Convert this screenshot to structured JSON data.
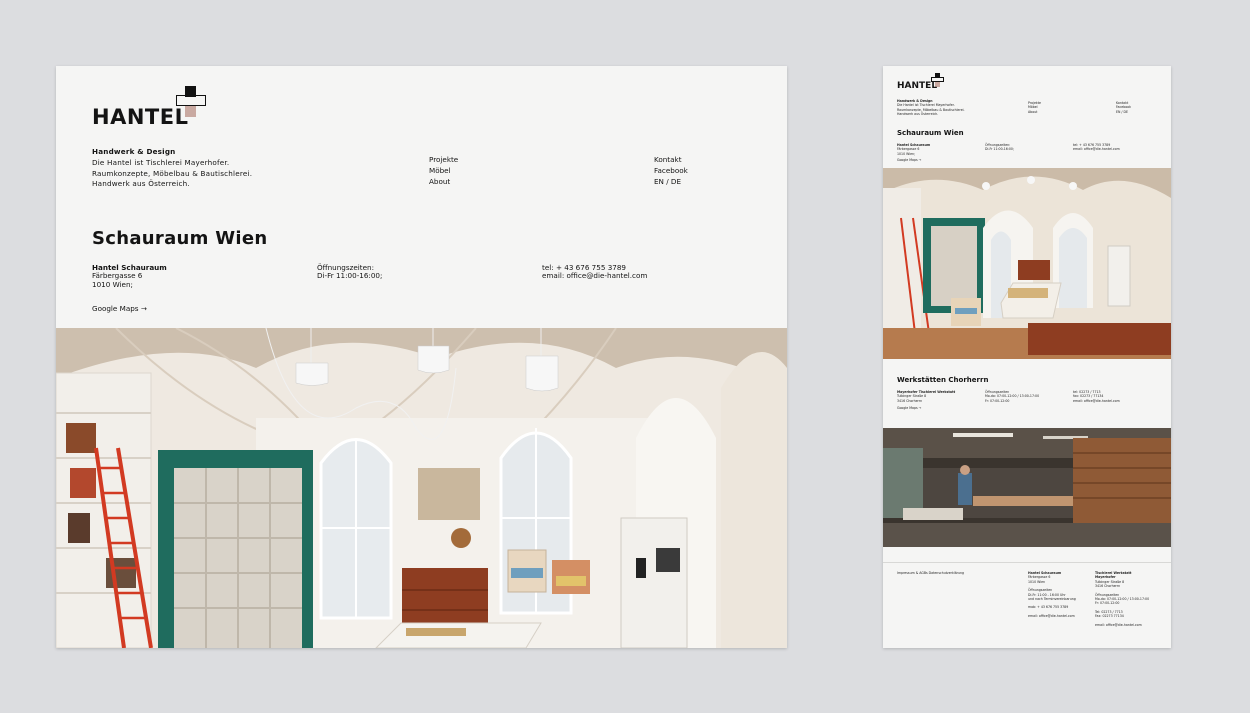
{
  "brand": {
    "logo_text": "HANTEL",
    "colors": {
      "accent_pink": "#c9a9a1",
      "green_shelf": "#1f6c5e",
      "red_ladder": "#d23a22"
    }
  },
  "intro": {
    "heading": "Handwerk & Design",
    "lines": [
      "Die Hantel ist Tischlerei Mayerhofer.",
      "Raumkonzepte, Möbelbau & Bautischlerei.",
      "Handwerk aus Österreich."
    ]
  },
  "nav": {
    "left": [
      "Projekte",
      "Möbel",
      "About"
    ],
    "right": [
      "Kontakt",
      "Facebook",
      "EN / DE"
    ]
  },
  "showroom": {
    "title": "Schauraum Wien",
    "address": {
      "name": "Hantel Schauraum",
      "street": "Färbergasse 6",
      "city": "1010 Wien;"
    },
    "hours": {
      "label": "Öffnungszeiten:",
      "value": "Di-Fr 11:00-16:00;"
    },
    "contact": {
      "tel": "tel: + 43 676 755 3789",
      "email": "email: office@die-hantel.com"
    },
    "maps_link": "Google Maps →"
  },
  "workshop": {
    "title": "Werkstätten Chorherrn",
    "address": {
      "name": "Mayerhofer Tischlerei Werkstatt",
      "street": "Tulbinger Straße 8",
      "city": "3416 Chorherrn"
    },
    "hours": {
      "label": "Öffnungszeiten",
      "value": "Mo-do: 07:00-12:00 / 13:00-17:00",
      "value2": "Fr: 07:00-12:00"
    },
    "contact": {
      "tel": "tel: 02273 / 7713",
      "fax": "fax: 02273 / 77134",
      "email": "email: office@die-hantel.com"
    },
    "maps_link": "Google Maps →"
  },
  "footer": {
    "legal": "Impressum & AGBs  Datenschutzerklärung",
    "col1": {
      "name": "Hantel Schauraum",
      "street": "Färbergasse 6",
      "city": "1010 Wien",
      "hours_label": "Öffnungszeiten",
      "hours": "Di-Fr: 11:00 - 16:00 Uhr",
      "hours2": "und nach Terminvereinbarung",
      "tel": "mob: + 43 676 755 3789",
      "email": "email: office@die-hantel.com"
    },
    "col2": {
      "name": "Tischlerei Werkstatt",
      "name2": "Mayerhofer",
      "street": "Tulbinger Straße 8",
      "city": "3416 Chorherrn",
      "hours_label": "Öffnungszeiten",
      "hours": "Mo-do: 07:00-12:00 / 13:00-17:00",
      "hours2": "Fr: 07:00-12:00",
      "tel": "Tel: 02273 / 7713",
      "fax": "Fax: 02273 77134",
      "email": "email: office@die-hantel.com"
    }
  }
}
